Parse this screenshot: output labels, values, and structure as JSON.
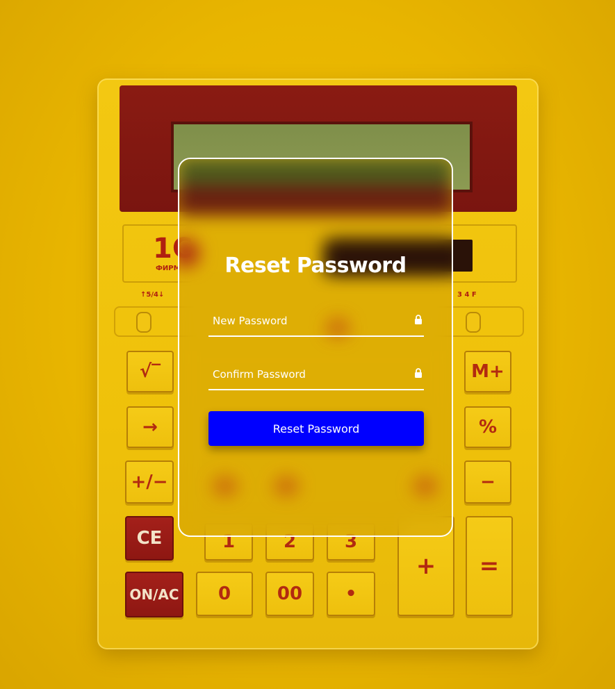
{
  "background": {
    "wall_color": "#e8b500",
    "calculator": {
      "brand_logo": "1С",
      "brand_sub": "ФИРМ",
      "decimal_label_left": "↑5/4↓",
      "decimal_label_right": "3 4 F",
      "keys": [
        {
          "id": "sqrt",
          "label": "√‾"
        },
        {
          "id": "arrow",
          "label": "→"
        },
        {
          "id": "plusminus",
          "label": "+/−"
        },
        {
          "id": "ce",
          "label": "CE"
        },
        {
          "id": "on_ac",
          "label": "ON/AC"
        },
        {
          "id": "one",
          "label": "1"
        },
        {
          "id": "two",
          "label": "2"
        },
        {
          "id": "three",
          "label": "3"
        },
        {
          "id": "zero",
          "label": "0"
        },
        {
          "id": "double_zero",
          "label": "00"
        },
        {
          "id": "dot",
          "label": "•"
        },
        {
          "id": "plus",
          "label": "+"
        },
        {
          "id": "equals",
          "label": "="
        },
        {
          "id": "m_plus",
          "label": "M+"
        },
        {
          "id": "percent",
          "label": "%"
        },
        {
          "id": "minus",
          "label": "−"
        }
      ]
    }
  },
  "card": {
    "title": "Reset Password",
    "fields": {
      "new_password": {
        "placeholder": "New Password",
        "icon": "lock-icon"
      },
      "confirm_password": {
        "placeholder": "Confirm Password",
        "icon": "lock-icon"
      }
    },
    "submit_label": "Reset Password",
    "accent_color": "#0000ff"
  }
}
